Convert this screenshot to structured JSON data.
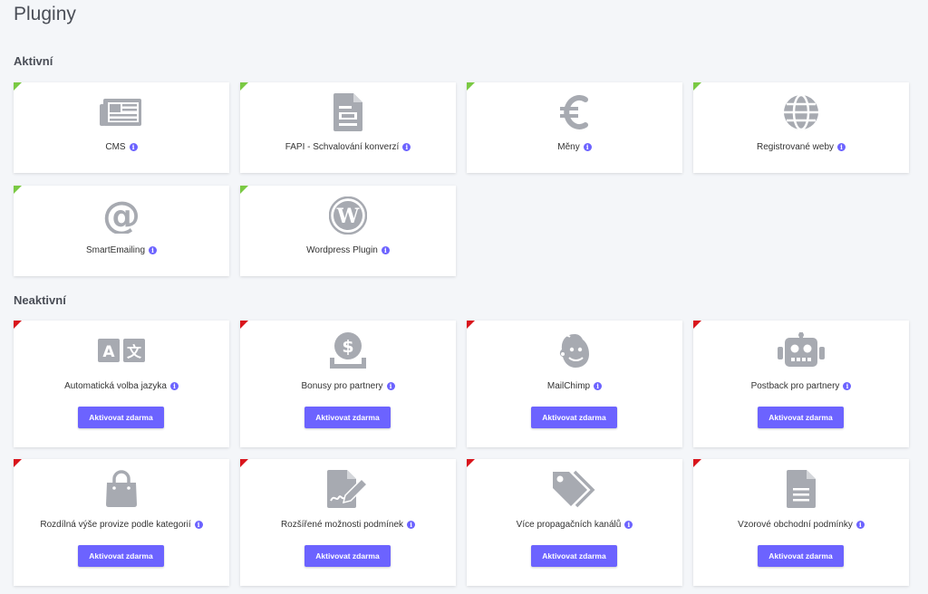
{
  "page": {
    "title": "Pluginy"
  },
  "sections": {
    "active": {
      "title": "Aktivní"
    },
    "inactive": {
      "title": "Neaktivní"
    }
  },
  "info_glyph": "i",
  "colors": {
    "active_marker": "#7ac943",
    "inactive_marker": "#d9151c",
    "accent": "#6c63ff",
    "icon_gray": "#a7aab1"
  },
  "active_plugins": [
    {
      "label": "CMS",
      "icon": "newspaper-icon"
    },
    {
      "label": "FAPI - Schvalování konverzí",
      "icon": "document-icon"
    },
    {
      "label": "Měny",
      "icon": "euro-icon"
    },
    {
      "label": "Registrované weby",
      "icon": "globe-icon"
    },
    {
      "label": "SmartEmailing",
      "icon": "at-sign-icon"
    },
    {
      "label": "Wordpress Plugin",
      "icon": "wordpress-icon"
    }
  ],
  "inactive_plugins": [
    {
      "label": "Automatická volba jazyka",
      "icon": "translate-icon",
      "button": "Aktivovat zdarma"
    },
    {
      "label": "Bonusy pro partnery",
      "icon": "money-icon",
      "button": "Aktivovat zdarma"
    },
    {
      "label": "MailChimp",
      "icon": "mailchimp-icon",
      "button": "Aktivovat zdarma"
    },
    {
      "label": "Postback pro partnery",
      "icon": "robot-icon",
      "button": "Aktivovat zdarma"
    },
    {
      "label": "Rozdílná výše provize podle kategorií",
      "icon": "shopping-bag-icon",
      "button": "Aktivovat zdarma"
    },
    {
      "label": "Rozšířené možnosti podmínek",
      "icon": "signature-icon",
      "button": "Aktivovat zdarma"
    },
    {
      "label": "Více propagačních kanálů",
      "icon": "tags-icon",
      "button": "Aktivovat zdarma"
    },
    {
      "label": "Vzorové obchodní podmínky",
      "icon": "file-text-icon",
      "button": "Aktivovat zdarma"
    }
  ]
}
